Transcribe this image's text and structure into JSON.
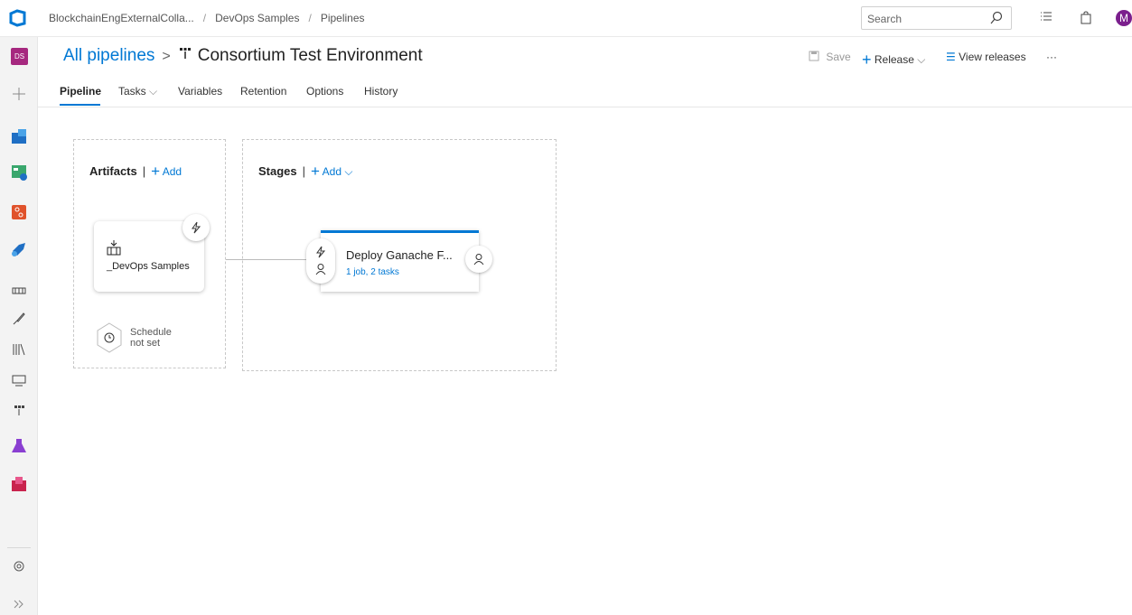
{
  "topbar": {
    "org": "BlockchainEngExternalColla...",
    "project": "DevOps Samples",
    "area": "Pipelines",
    "search_placeholder": "Search",
    "avatar_initial": "M"
  },
  "rail": {
    "project_badge": "DS",
    "items": [
      "add-icon",
      "overview-icon",
      "boards-icon",
      "repos-icon",
      "pipelines-icon",
      "builds-icon",
      "releases-icon",
      "library-icon",
      "deployment-groups-icon",
      "task-groups-icon",
      "test-plans-icon",
      "artifacts-icon",
      "settings-icon",
      "expand-icon"
    ]
  },
  "header": {
    "all_pipelines": "All pipelines",
    "chevron": ">",
    "pipeline_name": "Consortium Test Environment",
    "save": "Save",
    "release": "Release",
    "view_releases": "View releases",
    "more": "···"
  },
  "tabs": [
    {
      "label": "Pipeline",
      "active": true
    },
    {
      "label": "Tasks",
      "dropdown": true
    },
    {
      "label": "Variables"
    },
    {
      "label": "Retention"
    },
    {
      "label": "Options"
    },
    {
      "label": "History"
    }
  ],
  "artifacts": {
    "title": "Artifacts",
    "add": "Add",
    "item_label": "_DevOps Samples",
    "schedule_line1": "Schedule",
    "schedule_line2": "not set"
  },
  "stages": {
    "title": "Stages",
    "add": "Add",
    "stage_name": "Deploy Ganache F...",
    "stage_sub": "1 job, 2 tasks"
  },
  "colors": {
    "accent": "#0078d4",
    "avatar": "#7b1f8d",
    "project_badge": "#a6287f"
  }
}
